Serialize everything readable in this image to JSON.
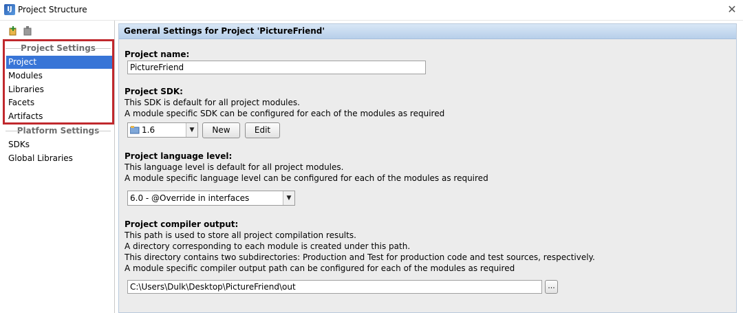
{
  "window": {
    "title": "Project Structure",
    "close_glyph": "✕"
  },
  "sidebar": {
    "toolbar": [
      {
        "name": "add-icon"
      },
      {
        "name": "remove-icon"
      }
    ],
    "sections": [
      {
        "header": "Project Settings",
        "items": [
          "Project",
          "Modules",
          "Libraries",
          "Facets",
          "Artifacts"
        ],
        "selected": "Project"
      },
      {
        "header": "Platform Settings",
        "items": [
          "SDKs",
          "Global Libraries"
        ]
      }
    ]
  },
  "main": {
    "header": "General Settings for Project 'PictureFriend'",
    "project_name": {
      "label": "Project name:",
      "value": "PictureFriend"
    },
    "sdk": {
      "label": "Project SDK:",
      "desc1": "This SDK is default for all project modules.",
      "desc2": "A module specific SDK can be configured for each of the modules as required",
      "selected": "1.6",
      "new_label": "New",
      "edit_label": "Edit"
    },
    "language_level": {
      "label": "Project language level:",
      "desc1": "This language level is default for all project modules.",
      "desc2": "A module specific language level can be configured for each of the modules as required",
      "selected": "6.0 - @Override in interfaces"
    },
    "compiler_output": {
      "label": "Project compiler output:",
      "desc1": "This path is used to store all project compilation results.",
      "desc2": "A directory corresponding to each module is created under this path.",
      "desc3": "This directory contains two subdirectories: Production and Test for production code and test sources, respectively.",
      "desc4": "A module specific compiler output path can be configured for each of the modules as required",
      "value": "C:\\Users\\Dulk\\Desktop\\PictureFriend\\out",
      "browse_label": "..."
    }
  },
  "colors": {
    "selection": "#3875d7",
    "highlight_box": "#c0282d",
    "header_gradient_top": "#d9e7f6"
  }
}
